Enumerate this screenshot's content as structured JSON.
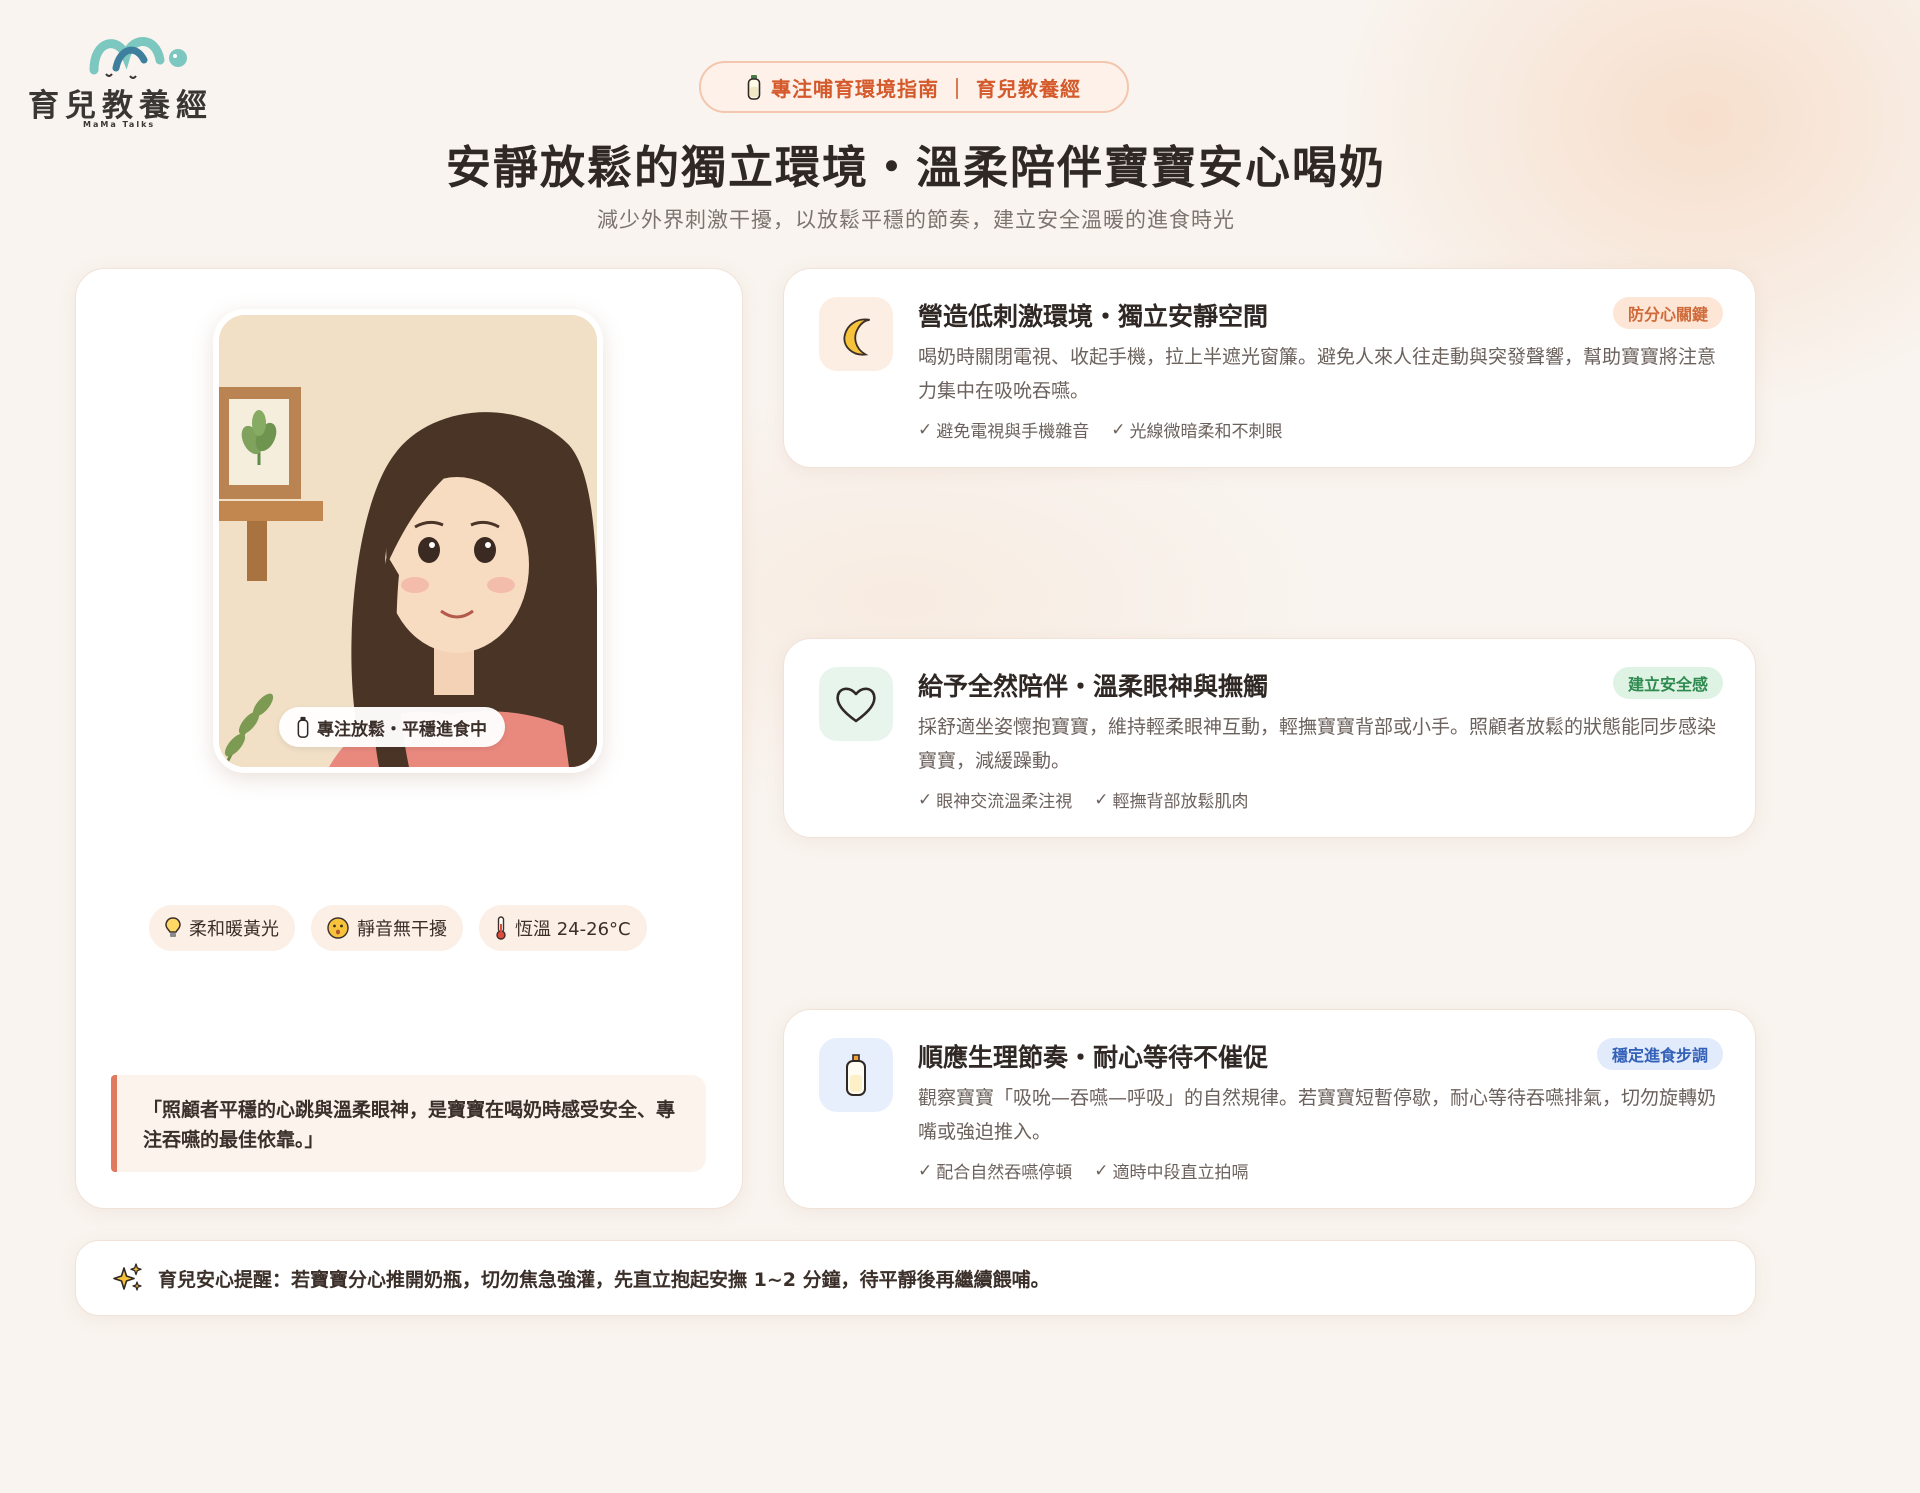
{
  "brand": {
    "name": "育兒教養經",
    "sub": "MaMa Talks"
  },
  "header": {
    "pill_text": "專注哺育環境指南 ｜ 育兒教養經",
    "title": "安靜放鬆的獨立環境・溫柔陪伴寶寶安心喝奶",
    "subtitle": "減少外界刺激干擾，以放鬆平穩的節奏，建立安全溫暖的進食時光"
  },
  "left_card": {
    "portrait_badge": "專注放鬆・平穩進食中",
    "chips": [
      {
        "icon": "bulb-icon",
        "label": "柔和暖黃光"
      },
      {
        "icon": "quiet-face-icon",
        "label": "靜音無干擾"
      },
      {
        "icon": "thermometer-icon",
        "label": "恆溫 24-26°C"
      }
    ],
    "quote": "「照顧者平穩的心跳與溫柔眼神，是寶寶在喝奶時感受安全、專注吞嚥的最佳依靠。」"
  },
  "features": [
    {
      "icon": "moon-icon",
      "title": "營造低刺激環境・獨立安靜空間",
      "tag": "防分心關鍵",
      "desc": "喝奶時關閉電視、收起手機，拉上半遮光窗簾。避免人來人往走動與突發聲響，幫助寶寶將注意力集中在吸吮吞嚥。",
      "checks": [
        "避免電視與手機雜音",
        "光線微暗柔和不刺眼"
      ]
    },
    {
      "icon": "heart-icon",
      "title": "給予全然陪伴・溫柔眼神與撫觸",
      "tag": "建立安全感",
      "desc": "採舒適坐姿懷抱寶寶，維持輕柔眼神互動，輕撫寶寶背部或小手。照顧者放鬆的狀態能同步感染寶寶，減緩躁動。",
      "checks": [
        "眼神交流溫柔注視",
        "輕撫背部放鬆肌肉"
      ]
    },
    {
      "icon": "bottle-icon",
      "title": "順應生理節奏・耐心等待不催促",
      "tag": "穩定進食步調",
      "desc": "觀察寶寶「吸吮—吞嚥—呼吸」的自然規律。若寶寶短暫停歇，耐心等待吞嚥排氣，切勿旋轉奶嘴或強迫推入。",
      "checks": [
        "配合自然吞嚥停頓",
        "適時中段直立拍嗝"
      ]
    }
  ],
  "tip": "育兒安心提醒：若寶寶分心推開奶瓶，切勿焦急強灌，先直立抱起安撫 1~2 分鐘，待平靜後再繼續餵哺。",
  "colors": {
    "accent": "#d45a2c",
    "tag_orange_bg": "#fde6d6",
    "tag_orange_fg": "#cf6a3a",
    "tag_green_bg": "#dff3e4",
    "tag_green_fg": "#2e8a4e",
    "tag_blue_bg": "#e1ebfb",
    "tag_blue_fg": "#3461b8",
    "quote_border": "#e07a5f"
  }
}
